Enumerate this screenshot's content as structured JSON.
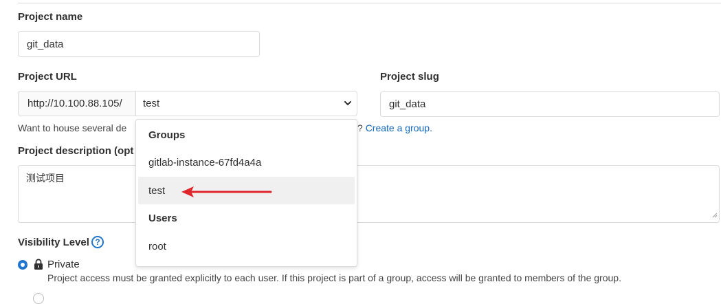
{
  "form": {
    "project_name_label": "Project name",
    "project_name_value": "git_data",
    "project_url_label": "Project URL",
    "url_prefix": "http://10.100.88.105/",
    "namespace_selected": "test",
    "project_slug_label": "Project slug",
    "project_slug_value": "git_data",
    "help_prefix": "Want to house several de",
    "help_suffix": "? ",
    "help_link": "Create a group.",
    "description_label": "Project description (opt",
    "description_value": "测试项目",
    "visibility_label": "Visibility Level",
    "private_label": "Private",
    "private_description": "Project access must be granted explicitly to each user. If this project is part of a group, access will be granted to members of the group."
  },
  "dropdown": {
    "groups_header": "Groups",
    "groups": [
      "gitlab-instance-67fd4a4a",
      "test"
    ],
    "users_header": "Users",
    "users": [
      "root"
    ]
  },
  "colors": {
    "accent": "#1f75cb",
    "link": "#1068bf",
    "annotation_arrow": "#e0262a",
    "highlight": "#f0f0f0"
  },
  "icons": {
    "chevron": "chevron-down-icon",
    "help": "question-circle-icon",
    "lock": "lock-icon",
    "arrow": "red-arrow-icon"
  }
}
